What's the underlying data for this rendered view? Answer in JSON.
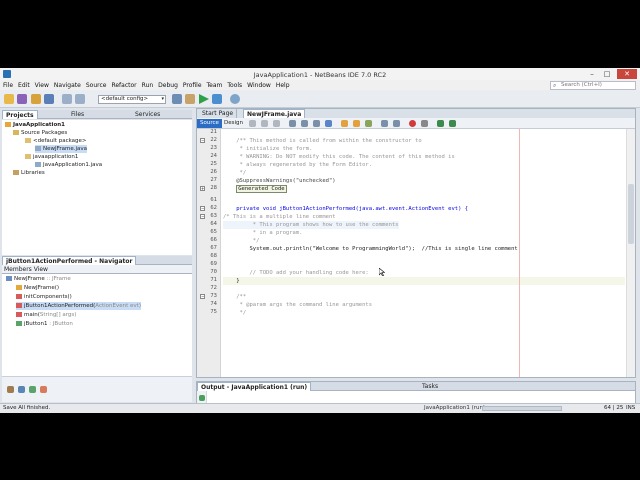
{
  "window": {
    "title": "JavaApplication1 - NetBeans IDE 7.0 RC2",
    "minimize": "–",
    "maximize": "□",
    "close": "✕"
  },
  "menu": [
    "File",
    "Edit",
    "View",
    "Navigate",
    "Source",
    "Refactor",
    "Run",
    "Debug",
    "Profile",
    "Team",
    "Tools",
    "Window",
    "Help"
  ],
  "search": {
    "placeholder": "Search (Ctrl+I)"
  },
  "toolbar": {
    "config": "<default config>"
  },
  "projects_panel": {
    "tabs": [
      "Projects",
      "Files",
      "Services"
    ],
    "tree": [
      {
        "label": "JavaApplication1",
        "depth": 0
      },
      {
        "label": "Source Packages",
        "depth": 1
      },
      {
        "label": "<default package>",
        "depth": 2
      },
      {
        "label": "NewJFrame.java",
        "depth": 3
      },
      {
        "label": "javaapplication1",
        "depth": 2
      },
      {
        "label": "JavaApplication1.java",
        "depth": 3
      },
      {
        "label": "Libraries",
        "depth": 1
      }
    ]
  },
  "navigator": {
    "title": "jButton1ActionPerformed - Navigator",
    "filter": "Members View",
    "items": [
      {
        "name": "NewJFrame",
        "type": " :: JFrame"
      },
      {
        "name": "NewJFrame()",
        "type": ""
      },
      {
        "name": "initComponents()",
        "type": ""
      },
      {
        "name": "jButton1ActionPerformed(",
        "type": "ActionEvent evt)"
      },
      {
        "name": "main(",
        "type": "String[] args)"
      },
      {
        "name": "jButton1",
        "type": " : JButton"
      }
    ]
  },
  "editor": {
    "tabs": [
      "Start Page",
      "NewJFrame.java"
    ],
    "views": [
      "Source",
      "Design"
    ],
    "lines": [
      {
        "n": "21",
        "text": ""
      },
      {
        "n": "22",
        "text": "    /** This method is called from within the constructor to",
        "cls": "c-com"
      },
      {
        "n": "23",
        "text": "     * initialize the form.",
        "cls": "c-com"
      },
      {
        "n": "24",
        "text": "     * WARNING: Do NOT modify this code. The content of this method is",
        "cls": "c-com"
      },
      {
        "n": "25",
        "text": "     * always regenerated by the Form Editor.",
        "cls": "c-com"
      },
      {
        "n": "26",
        "text": "     */",
        "cls": "c-com"
      },
      {
        "n": "27",
        "text": "    @SuppressWarnings(\"unchecked\")",
        "cls": "c-ann"
      },
      {
        "n": "28",
        "text": "    Generated Code",
        "cls": "guard"
      },
      {
        "n": "61",
        "text": ""
      },
      {
        "n": "62",
        "text": "    private void jButton1ActionPerformed(java.awt.event.ActionEvent evt) {",
        "cls": "c-kw"
      },
      {
        "n": "63",
        "text": "/* This is a multiple line comment",
        "cls": "c-com"
      },
      {
        "n": "64",
        "text": "         * This program shows how to use the comments",
        "cls": "c-com"
      },
      {
        "n": "65",
        "text": "         * in a program.",
        "cls": "c-com"
      },
      {
        "n": "66",
        "text": "         */",
        "cls": "c-com"
      },
      {
        "n": "67",
        "text": "        System.out.println(\"Welcome to ProgrammingWorld\");  //This is single line comment",
        "cls": ""
      },
      {
        "n": "68",
        "text": ""
      },
      {
        "n": "69",
        "text": ""
      },
      {
        "n": "70",
        "text": "        // TODO add your handling code here:",
        "cls": "c-com"
      },
      {
        "n": "71",
        "text": "    }",
        "cls": ""
      },
      {
        "n": "72",
        "text": ""
      },
      {
        "n": "73",
        "text": "    /**",
        "cls": "c-com"
      },
      {
        "n": "74",
        "text": "     * @param args the command line arguments",
        "cls": "c-com"
      },
      {
        "n": "75",
        "text": "     */",
        "cls": "c-com"
      }
    ]
  },
  "output": {
    "tabs": [
      "Output - JavaApplication1 (run)",
      "Tasks"
    ]
  },
  "status": {
    "left": "Save All finished.",
    "task": "JavaApplication1 (run)",
    "position": "64 | 25",
    "mode": "INS"
  }
}
